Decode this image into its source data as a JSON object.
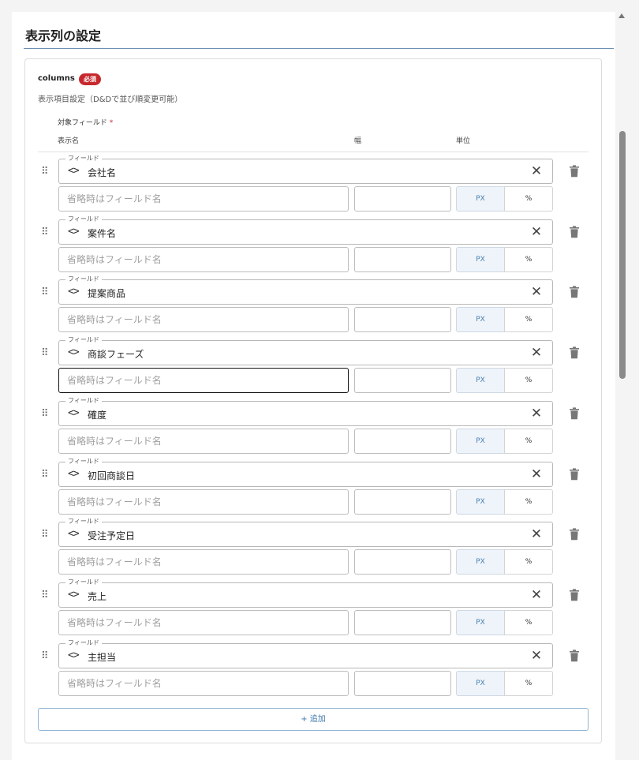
{
  "section": {
    "title": "表示列の設定"
  },
  "columns": {
    "name": "columns",
    "required_badge": "必須",
    "description": "表示項目設定（D&Dで並び順変更可能）",
    "target_field_label": "対象フィールド",
    "required_mark": "*",
    "headers": {
      "display_name": "表示名",
      "width": "幅",
      "unit": "単位"
    },
    "field_legend": "フィールド",
    "name_placeholder": "省略時はフィールド名",
    "unit_px": "PX",
    "unit_percent": "%",
    "rows": [
      {
        "field": "会社名"
      },
      {
        "field": "案件名"
      },
      {
        "field": "提案商品"
      },
      {
        "field": "商談フェーズ"
      },
      {
        "field": "確度"
      },
      {
        "field": "初回商談日"
      },
      {
        "field": "受注予定日"
      },
      {
        "field": "売上"
      },
      {
        "field": "主担当"
      }
    ],
    "add_button_label": "+ 追加",
    "focused_row_index": 3
  },
  "icons": {
    "drag": "drag-handle-icon",
    "code": "code-brackets-icon",
    "clear": "close-icon",
    "delete": "trash-icon"
  },
  "colors": {
    "required": "#c6282d",
    "accent": "#3f78ad",
    "px_selected_bg": "#eef4fa"
  }
}
